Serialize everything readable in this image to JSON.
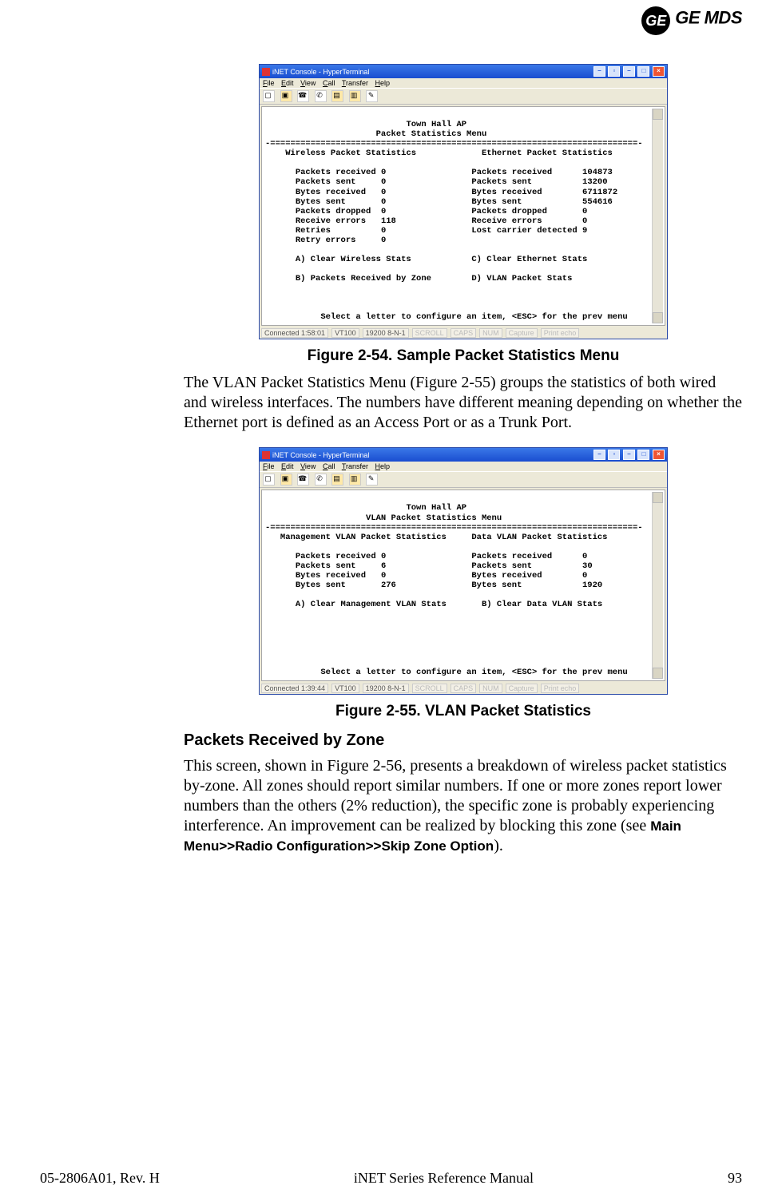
{
  "header": {
    "brand1": "GE",
    "brand2": "GE MDS"
  },
  "win1": {
    "title": "iNET Console - HyperTerminal",
    "menus": {
      "file": "File",
      "edit": "Edit",
      "view": "View",
      "call": "Call",
      "transfer": "Transfer",
      "help": "Help"
    },
    "status": {
      "conn": "Connected 1:58:01",
      "emu": "VT100",
      "baud": "19200 8-N-1",
      "scroll": "SCROLL",
      "caps": "CAPS",
      "num": "NUM",
      "capture": "Capture",
      "echo": "Print echo"
    },
    "screen": {
      "title1": "Town Hall AP",
      "title2": "Packet Statistics Menu",
      "sep": "-=========================================================================-",
      "col1": "Wireless Packet Statistics",
      "col2": "Ethernet Packet Statistics",
      "wireless": {
        "packets_received": {
          "label": "Packets received",
          "value": "0"
        },
        "packets_sent": {
          "label": "Packets sent",
          "value": "0"
        },
        "bytes_received": {
          "label": "Bytes received",
          "value": "0"
        },
        "bytes_sent": {
          "label": "Bytes sent",
          "value": "0"
        },
        "packets_dropped": {
          "label": "Packets dropped",
          "value": "0"
        },
        "receive_errors": {
          "label": "Receive errors",
          "value": "118"
        },
        "retries": {
          "label": "Retries",
          "value": "0"
        },
        "retry_errors": {
          "label": "Retry errors",
          "value": "0"
        }
      },
      "ethernet": {
        "packets_received": {
          "label": "Packets received",
          "value": "104873"
        },
        "packets_sent": {
          "label": "Packets sent",
          "value": "13200"
        },
        "bytes_received": {
          "label": "Bytes received",
          "value": "6711872"
        },
        "bytes_sent": {
          "label": "Bytes sent",
          "value": "554616"
        },
        "packets_dropped": {
          "label": "Packets dropped",
          "value": "0"
        },
        "receive_errors": {
          "label": "Receive errors",
          "value": "0"
        },
        "lost_carrier": {
          "label": "Lost carrier detected",
          "value": "9"
        }
      },
      "optA": "A) Clear Wireless Stats",
      "optC": "C) Clear Ethernet Stats",
      "optB": "B) Packets Received by Zone",
      "optD": "D) VLAN Packet Stats",
      "footer": "Select a letter to configure an item, <ESC> for the prev menu"
    }
  },
  "win2": {
    "title": "iNET Console - HyperTerminal",
    "menus": {
      "file": "File",
      "edit": "Edit",
      "view": "View",
      "call": "Call",
      "transfer": "Transfer",
      "help": "Help"
    },
    "status": {
      "conn": "Connected 1:39:44",
      "emu": "VT100",
      "baud": "19200 8-N-1",
      "scroll": "SCROLL",
      "caps": "CAPS",
      "num": "NUM",
      "capture": "Capture",
      "echo": "Print echo"
    },
    "screen": {
      "title1": "Town Hall AP",
      "title2": "VLAN Packet Statistics Menu",
      "sep": "-=========================================================================-",
      "col1": "Management VLAN Packet Statistics",
      "col2": "Data VLAN Packet Statistics",
      "mgmt": {
        "packets_received": {
          "label": "Packets received",
          "value": "0"
        },
        "packets_sent": {
          "label": "Packets sent",
          "value": "6"
        },
        "bytes_received": {
          "label": "Bytes received",
          "value": "0"
        },
        "bytes_sent": {
          "label": "Bytes sent",
          "value": "276"
        }
      },
      "data": {
        "packets_received": {
          "label": "Packets received",
          "value": "0"
        },
        "packets_sent": {
          "label": "Packets sent",
          "value": "30"
        },
        "bytes_received": {
          "label": "Bytes received",
          "value": "0"
        },
        "bytes_sent": {
          "label": "Bytes sent",
          "value": "1920"
        }
      },
      "optA": "A) Clear Management VLAN Stats",
      "optB": "B) Clear Data VLAN Stats",
      "footer": "Select a letter to configure an item, <ESC> for the prev menu"
    }
  },
  "captions": {
    "fig254": "Figure 2-54. Sample Packet Statistics Menu",
    "fig255": "Figure 2-55. VLAN Packet Statistics"
  },
  "paragraphs": {
    "p1": "The VLAN Packet Statistics Menu (Figure 2-55) groups the statistics of both wired and wireless interfaces. The numbers have different meaning depending on whether the Ethernet port is defined as an Access Port or as a Trunk Port.",
    "h1": "Packets Received by Zone",
    "p2a": "This screen, shown in Figure 2-56, presents a breakdown of wireless packet statistics by-zone. All zones should report similar numbers. If one or more zones report lower numbers than the others (2% reduction), the specific zone is probably experiencing interference. An improvement can be realized by blocking this zone (see ",
    "p2b": "Main Menu>>Radio Configuration>>Skip Zone Option",
    "p2c": ")."
  },
  "footer": {
    "left": "05-2806A01, Rev. H",
    "center": "iNET Series Reference Manual",
    "right": "93"
  }
}
